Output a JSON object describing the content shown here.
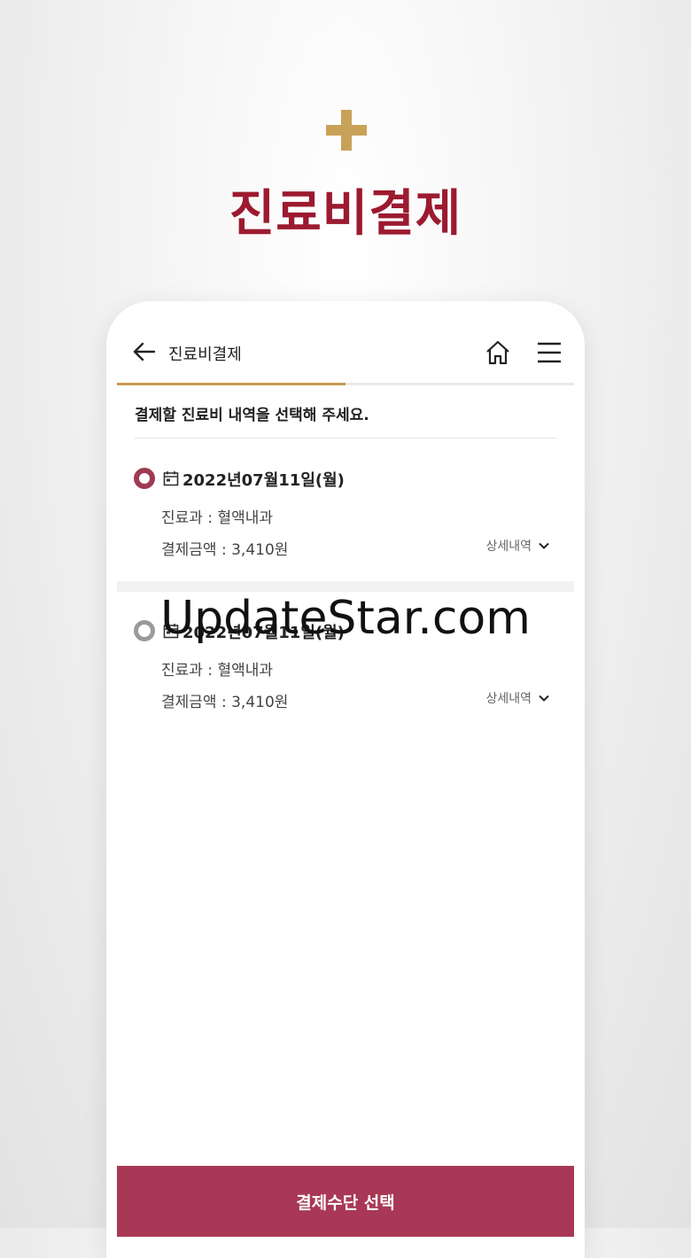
{
  "promo": {
    "title": "진료비결제"
  },
  "header": {
    "title": "진료비결제",
    "progress": 0.5
  },
  "instruction": "결제할 진료비 내역을 선택해 주세요.",
  "records": [
    {
      "date": "2022년07월11일(월)",
      "dept": "진료과 : 혈액내과",
      "amount": "결제금액 : 3,410원",
      "detail_label": "상세내역",
      "selected": true
    },
    {
      "date": "2022년07월11일(월)",
      "dept": "진료과 : 혈액내과",
      "amount": "결제금액 : 3,410원",
      "detail_label": "상세내역",
      "selected": false
    }
  ],
  "pay_button": "결제수단 선택",
  "watermark": "UpdateStar.com",
  "colors": {
    "brand": "#9c1a2f",
    "accent_gold": "#c9a25a",
    "button": "#a83855",
    "radio_selected": "#a03a52"
  },
  "icons": [
    "plus-icon",
    "back-arrow-icon",
    "home-icon",
    "menu-icon",
    "calendar-icon",
    "chevron-down-icon"
  ]
}
